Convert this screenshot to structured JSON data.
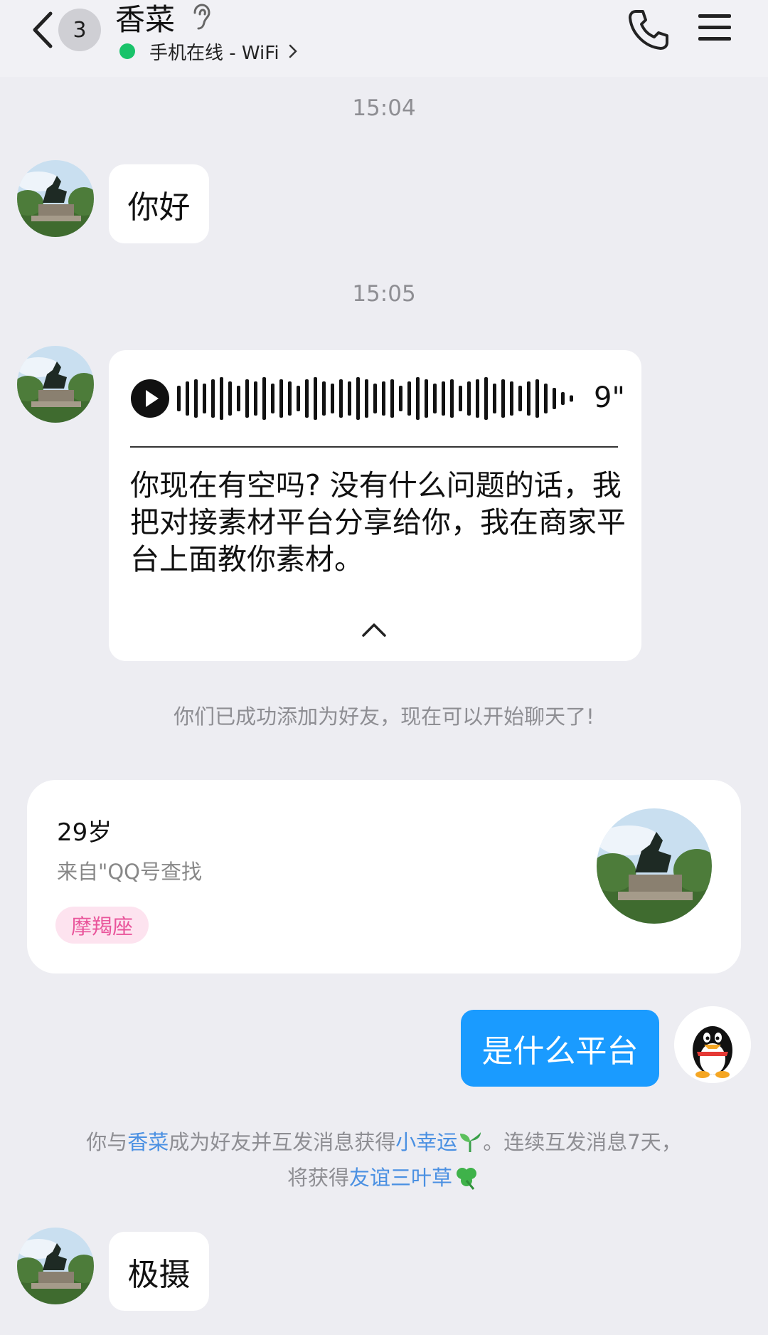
{
  "header": {
    "back_label": "back",
    "unread_count": "3",
    "contact_name": "香菜",
    "status": "手机在线 - WiFi",
    "status_color": "#19c36a"
  },
  "messages": {
    "time_1": "15:04",
    "greeting": "你好",
    "time_2": "15:05",
    "voice_duration": "9\"",
    "voice_transcript": "你现在有空吗? 没有什么问题的话，我把对接素材平台分享给你，我在商家平台上面教你素材。",
    "friend_added_notice": "你们已成功添加为好友，现在可以开始聊天了!",
    "sent_message": "是什么平台",
    "last_message": "极摄"
  },
  "profile_card": {
    "age": "29岁",
    "source": "来自\"QQ号查找",
    "zodiac": "摩羯座",
    "zodiac_color": "#e9559b"
  },
  "lucky_notice": {
    "prefix": "你与",
    "name_link": "香菜",
    "middle": "成为好友并互发消息获得",
    "badge_link": "小幸运",
    "tail": "。连续互发消息7天，",
    "line2_prefix": "将获得",
    "line2_link": "友谊三叶草",
    "link_color": "#4a90e2"
  },
  "colors": {
    "background": "#ededf2",
    "sent_bubble": "#1a9bff"
  }
}
